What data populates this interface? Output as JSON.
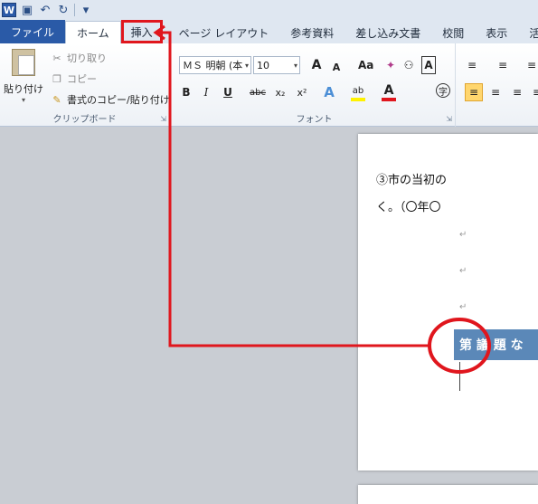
{
  "qat": {
    "app_icon_letter": "W"
  },
  "tabs": {
    "file": "ファイル",
    "home": "ホーム",
    "insert": "挿入",
    "page_layout": "ページ レイアウト",
    "references": "参考資料",
    "mailings": "差し込み文書",
    "review": "校閲",
    "view": "表示",
    "more": "活用し"
  },
  "clipboard": {
    "paste": "貼り付け",
    "cut": "切り取り",
    "copy": "コピー",
    "format_painter": "書式のコピー/貼り付け",
    "group_label": "クリップボード"
  },
  "font": {
    "name": "ＭＳ 明朝 (本",
    "size": "10",
    "grow": "A",
    "shrink": "A",
    "change_case": "Aa",
    "bold": "B",
    "italic": "I",
    "underline": "U",
    "strike": "abc",
    "subscript": "x₂",
    "superscript": "x²",
    "group_label": "フォント"
  },
  "document": {
    "line1": "③市の当初の",
    "line2": "く。（〇年〇",
    "heading": "第 議 題 な",
    "para_mark": "↵"
  },
  "colors": {
    "accent": "#2a5aa7",
    "annotation": "#e0161d",
    "highlight": "#5b88b8"
  }
}
